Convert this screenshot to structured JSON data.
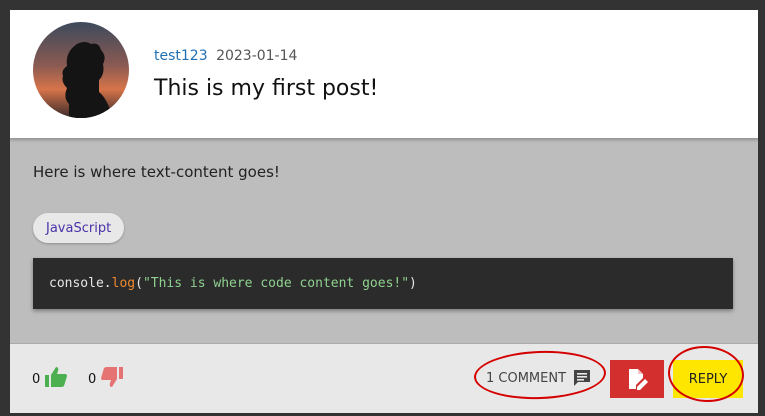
{
  "post": {
    "username": "test123",
    "date": "2023-01-14",
    "title": "This is my first post!",
    "text": "Here is where text-content goes!",
    "language": "JavaScript",
    "code": {
      "object": "console",
      "dot": ".",
      "method": "log",
      "open": "(",
      "string": "\"This is where code content goes!\"",
      "close": ")"
    }
  },
  "footer": {
    "upvotes": "0",
    "downvotes": "0",
    "comments_label": "1 COMMENT",
    "reply_label": "REPLY"
  },
  "colors": {
    "username": "#1f6fb5",
    "language_chip_text": "#4a32a8",
    "edit_button": "#d32f2f",
    "reply_button": "#ffe600",
    "thumb_up": "#4caf50",
    "thumb_down": "#e57373",
    "annotation": "#d40000"
  },
  "icons": [
    "avatar-silhouette",
    "thumb-up-icon",
    "thumb-down-icon",
    "comment-icon",
    "edit-document-icon"
  ]
}
